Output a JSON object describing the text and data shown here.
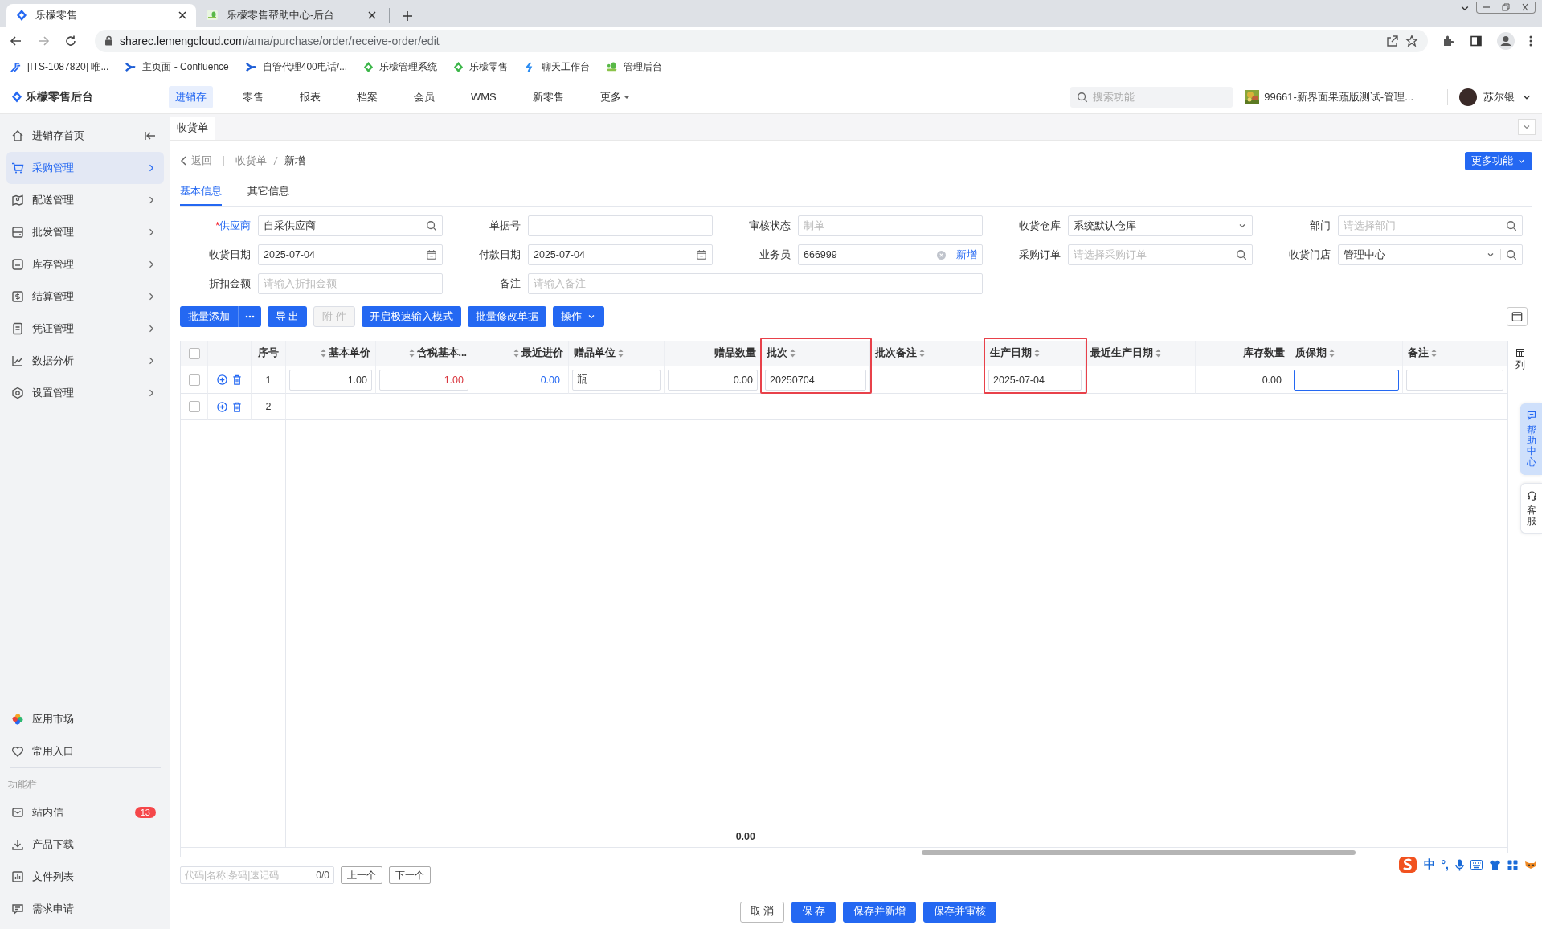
{
  "browser": {
    "tabs": [
      {
        "title": "乐檬零售",
        "selected": true
      },
      {
        "title": "乐檬零售帮助中心-后台",
        "selected": false
      }
    ],
    "url": {
      "host": "sharec.lemengcloud.com",
      "path": "/ama/purchase/order/receive-order/edit"
    },
    "bookmarks": [
      {
        "label": "[ITS-1087820] 唯...",
        "kind": "jira"
      },
      {
        "label": "主页面 - Confluence",
        "kind": "confluence"
      },
      {
        "label": "自管代理400电话/...",
        "kind": "confluence"
      },
      {
        "label": "乐檬管理系统",
        "kind": "diamond"
      },
      {
        "label": "乐檬零售",
        "kind": "diamond"
      },
      {
        "label": "聊天工作台",
        "kind": "chat"
      },
      {
        "label": "管理后台",
        "kind": "lemon"
      }
    ]
  },
  "header": {
    "logo": "乐檬零售后台",
    "nav": [
      {
        "label": "进销存",
        "selected": true,
        "dropdown": false
      },
      {
        "label": "零售",
        "selected": false,
        "dropdown": false
      },
      {
        "label": "报表",
        "selected": false,
        "dropdown": false
      },
      {
        "label": "档案",
        "selected": false,
        "dropdown": false
      },
      {
        "label": "会员",
        "selected": false,
        "dropdown": false
      },
      {
        "label": "WMS",
        "selected": false,
        "dropdown": false
      },
      {
        "label": "新零售",
        "selected": false,
        "dropdown": false
      },
      {
        "label": "更多",
        "selected": false,
        "dropdown": true
      }
    ],
    "search": {
      "placeholder": "搜索功能"
    },
    "store": "99661-新界面果蔬版测试-管理...",
    "user": "苏尔银"
  },
  "sidebar": {
    "items": [
      {
        "label": "进销存首页",
        "selected": false
      },
      {
        "label": "采购管理",
        "selected": true
      },
      {
        "label": "配送管理",
        "selected": false
      },
      {
        "label": "批发管理",
        "selected": false
      },
      {
        "label": "库存管理",
        "selected": false
      },
      {
        "label": "结算管理",
        "selected": false
      },
      {
        "label": "凭证管理",
        "selected": false
      },
      {
        "label": "数据分析",
        "selected": false
      },
      {
        "label": "设置管理",
        "selected": false
      }
    ],
    "bottom_items": [
      {
        "label": "应用市场"
      },
      {
        "label": "常用入口"
      }
    ],
    "section_title": "功能栏",
    "tools": [
      {
        "label": "站内信",
        "badge": "13"
      },
      {
        "label": "产品下载"
      },
      {
        "label": "文件列表"
      },
      {
        "label": "需求申请"
      }
    ]
  },
  "page_tabs": [
    {
      "label": "收货单"
    }
  ],
  "breadcrumb": {
    "back": "返回",
    "items": [
      "收货单",
      "新增"
    ]
  },
  "more_button": "更多功能",
  "form_tabs": [
    {
      "label": "基本信息",
      "selected": true
    },
    {
      "label": "其它信息",
      "selected": false
    }
  ],
  "fields": [
    {
      "label": "供应商",
      "required": true,
      "required_mark": "*",
      "kind": "search",
      "value": "自采供应商"
    },
    {
      "label": "单据号",
      "required": false,
      "kind": "text"
    },
    {
      "label": "审核状态",
      "required": false,
      "kind": "text",
      "placeholder": "制单"
    },
    {
      "label": "收货仓库",
      "required": false,
      "kind": "select",
      "value": "系统默认仓库"
    },
    {
      "label": "部门",
      "required": false,
      "kind": "search",
      "placeholder": "请选择部门"
    },
    {
      "label": "收货日期",
      "required": false,
      "kind": "date",
      "value": "2025-07-04"
    },
    {
      "label": "付款日期",
      "required": false,
      "kind": "date",
      "value": "2025-07-04"
    },
    {
      "label": "业务员",
      "required": false,
      "kind": "clearable",
      "value": "666999",
      "action": "新增"
    },
    {
      "label": "采购订单",
      "required": false,
      "kind": "search",
      "placeholder": "请选择采购订单"
    },
    {
      "label": "收货门店",
      "required": false,
      "kind": "select_search",
      "value": "管理中心"
    },
    {
      "label": "折扣金额",
      "required": false,
      "kind": "text",
      "placeholder": "请输入折扣金额"
    },
    {
      "label": "备注",
      "required": false,
      "kind": "wide",
      "placeholder": "请输入备注"
    }
  ],
  "toolbar": [
    {
      "label": "批量添加",
      "kind": "split",
      "disabled": false
    },
    {
      "label": "导 出",
      "kind": "plain",
      "disabled": false
    },
    {
      "label": "附 件",
      "kind": "plain",
      "disabled": true
    },
    {
      "label": "开启极速输入模式",
      "kind": "plain",
      "disabled": false
    },
    {
      "label": "批量修改单据",
      "kind": "plain",
      "disabled": false
    },
    {
      "label": "操作",
      "kind": "dropdown",
      "disabled": false
    }
  ],
  "table": {
    "all_checked": false,
    "columns": [
      {
        "label": "序号",
        "sortable": false,
        "highlighted": false
      },
      {
        "label": "基本单价",
        "sortable": true,
        "highlighted": false
      },
      {
        "label": "含税基本...",
        "sortable": true,
        "highlighted": false
      },
      {
        "label": "最近进价",
        "sortable": true,
        "highlighted": false
      },
      {
        "label": "赠品单位",
        "sortable": true,
        "highlighted": false
      },
      {
        "label": "赠品数量",
        "sortable": false,
        "highlighted": false
      },
      {
        "label": "批次",
        "sortable": true,
        "highlighted": true
      },
      {
        "label": "批次备注",
        "sortable": true,
        "highlighted": false
      },
      {
        "label": "生产日期",
        "sortable": true,
        "highlighted": true
      },
      {
        "label": "最近生产日期",
        "sortable": true,
        "highlighted": false
      },
      {
        "label": "库存数量",
        "sortable": false,
        "highlighted": false
      },
      {
        "label": "质保期",
        "sortable": true,
        "highlighted": false
      },
      {
        "label": "备注",
        "sortable": true,
        "highlighted": false
      }
    ],
    "rows": [
      {
        "index": "1",
        "checked": false,
        "cells": [
          {
            "kind": "input",
            "value": "1.00",
            "focused": false
          },
          {
            "kind": "input",
            "value": "1.00",
            "color": "#d9363e",
            "focused": false
          },
          {
            "kind": "text",
            "value": "0.00",
            "color": "#2468f2"
          },
          {
            "kind": "input",
            "value": "瓶",
            "focused": false
          },
          {
            "kind": "input",
            "value": "0.00",
            "focused": false
          },
          {
            "kind": "input",
            "value": "20250704",
            "focused": false
          },
          {
            "kind": "empty"
          },
          {
            "kind": "input",
            "value": "2025-07-04",
            "focused": false
          },
          {
            "kind": "empty"
          },
          {
            "kind": "text",
            "value": "0.00"
          },
          {
            "kind": "input",
            "focused": true
          },
          {
            "kind": "input",
            "focused": false
          }
        ]
      },
      {
        "index": "2",
        "checked": false
      }
    ],
    "footer": {
      "total": "0.00"
    }
  },
  "column_settings": "列",
  "search_bar": {
    "placeholder": "代码|名称|条码|速记码",
    "count": "0/0",
    "prev": "上一个",
    "next": "下一个"
  },
  "actions": [
    {
      "label": "取 消",
      "primary": false
    },
    {
      "label": "保 存",
      "primary": true
    },
    {
      "label": "保存并新增",
      "primary": true
    },
    {
      "label": "保存并审核",
      "primary": true
    }
  ],
  "side_tabs": [
    {
      "label": "帮助中心",
      "selected": true
    },
    {
      "label": "客服",
      "selected": false
    }
  ],
  "ime": {
    "mode": "中",
    "punct": "°,"
  }
}
